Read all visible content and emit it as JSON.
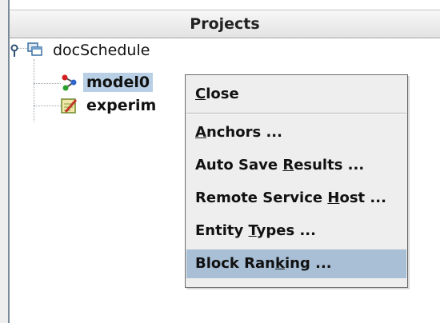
{
  "panel": {
    "title": "Projects"
  },
  "tree": {
    "root": {
      "label": "docSchedule"
    },
    "children": [
      {
        "label": "model0",
        "selected": true
      },
      {
        "label": "experim"
      }
    ]
  },
  "context_menu": {
    "items": [
      {
        "label": "Close",
        "mnemonic_index": 0
      },
      {
        "label": "Anchors ...",
        "mnemonic_index": 0
      },
      {
        "label": "Auto Save Results ...",
        "mnemonic_index": 10
      },
      {
        "label": "Remote Service Host ...",
        "mnemonic_index": 15
      },
      {
        "label": "Entity Types ...",
        "mnemonic_index": 7
      },
      {
        "label": "Block Ranking ...",
        "mnemonic_index": 9,
        "highlighted": true
      }
    ]
  },
  "colors": {
    "selection": "#b8cfe5",
    "menu_highlight": "#a9bfd6",
    "menu_background": "#eeeeee"
  }
}
